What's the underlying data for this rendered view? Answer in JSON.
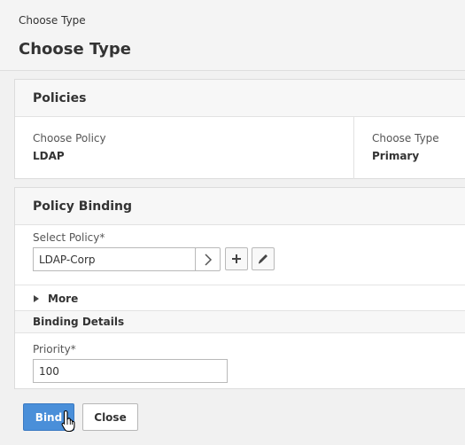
{
  "header": {
    "breadcrumb": "Choose Type",
    "title": "Choose Type"
  },
  "policies": {
    "title": "Policies",
    "choose_policy_label": "Choose Policy",
    "choose_policy_value": "LDAP",
    "choose_type_label": "Choose Type",
    "choose_type_value": "Primary"
  },
  "binding": {
    "title": "Policy Binding",
    "select_policy_label": "Select Policy*",
    "select_policy_value": "LDAP-Corp",
    "more_label": "More",
    "details_title": "Binding Details",
    "priority_label": "Priority*",
    "priority_value": "100"
  },
  "actions": {
    "bind_label": "Bind",
    "close_label": "Close"
  },
  "colors": {
    "primary_button": "#4a8fd9",
    "page_background": "#f1f1f1"
  },
  "icons": [
    "chevron-right-icon",
    "plus-icon",
    "pencil-icon",
    "caret-right-icon",
    "hand-cursor-icon"
  ]
}
